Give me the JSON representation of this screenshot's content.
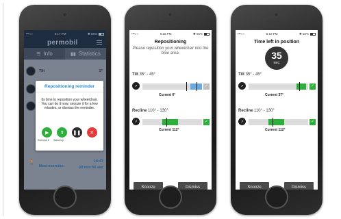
{
  "colors": {
    "accent_blue": "#2a8ad0",
    "success_green": "#2eae3a",
    "danger_red": "#e33a3a",
    "dark_button": "#4a4a4a",
    "app_header": "#1d2c3f"
  },
  "phone1": {
    "status": {
      "carrier": "•••○○",
      "time": "6:17 PM",
      "right": "✱ 56%"
    },
    "app": {
      "logo": "permobil",
      "tabs": [
        {
          "label": "Info",
          "icon": "list-icon"
        },
        {
          "label": "Statistics",
          "icon": "bar-chart-icon"
        }
      ],
      "rows": [
        {
          "label": "Tilt",
          "value": "2°"
        },
        {
          "label": "",
          "value": "1°"
        },
        {
          "label": "",
          "value": ""
        }
      ],
      "next_exercise": {
        "label": "Next exercise:",
        "time": "16:47",
        "remaining": "20 min 56 sec"
      }
    },
    "modal": {
      "title": "Repositioning reminder",
      "body": "Its time to reposition your wheelchair. You can do it now, snooze it for a few minutes, or dismiss the reminder.",
      "actions": [
        {
          "name": "exercise-2",
          "label": "Exercise 2"
        },
        {
          "name": "stand-up",
          "label": "Stand Up"
        },
        {
          "name": "pause",
          "label": ""
        },
        {
          "name": "dismiss",
          "label": ""
        }
      ]
    }
  },
  "phone2": {
    "status": {
      "carrier": "•••○○",
      "time": "6:18 PM",
      "right": "✱ 56%"
    },
    "title": "Repositioning",
    "subtitle": "Please reposition your wheelchair into the blue area.",
    "tilt": {
      "label": "Tilt",
      "range": "35° - 45°",
      "current": "Current 6°",
      "done": false
    },
    "recline": {
      "label": "Recline",
      "range": "110° - 130°",
      "current": "Current 112°",
      "done": true
    },
    "snooze_label": "Snooze",
    "dismiss_label": "Dismiss"
  },
  "phone3": {
    "status": {
      "carrier": "•••○○",
      "time": "6:19 PM",
      "right": "✱ 56%"
    },
    "title": "Time left in position",
    "timer": {
      "value": "35",
      "unit": "SEC"
    },
    "tilt": {
      "label": "Tilt",
      "range": "35° - 45°",
      "current": "Current 37°",
      "done": true
    },
    "recline": {
      "label": "Recline",
      "range": "110° - 130°",
      "current": "Current 112°",
      "done": true
    },
    "snooze_label": "Snooze",
    "dismiss_label": "Dismiss"
  }
}
